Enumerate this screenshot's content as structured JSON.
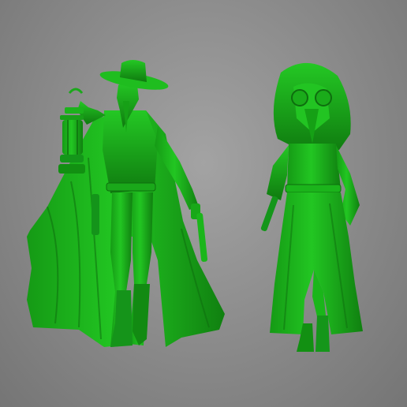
{
  "scene": {
    "subjects": [
      {
        "icon": "plague-doctor-gunslinger-miniature"
      },
      {
        "icon": "plague-doctor-woman-miniature"
      }
    ]
  },
  "colors": {
    "background_light": "#a3a3a3",
    "background_dark": "#757575",
    "model_base": "#20c020",
    "model_shadow": "#0e6e0e",
    "model_highlight": "#46e046"
  }
}
